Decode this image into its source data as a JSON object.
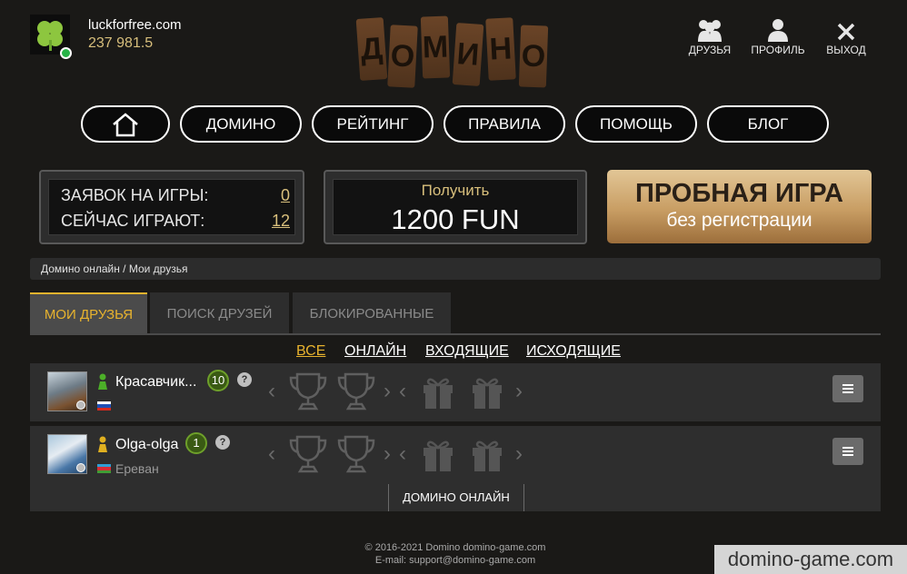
{
  "header": {
    "site_name": "luckforfree.com",
    "balance": "237 981.5",
    "brand_letters": [
      "Д",
      "О",
      "М",
      "И",
      "Н",
      "О"
    ],
    "links": [
      {
        "label": "ДРУЗЬЯ",
        "icon": "friends-icon"
      },
      {
        "label": "ПРОФИЛЬ",
        "icon": "profile-icon"
      },
      {
        "label": "ВЫХОД",
        "icon": "close-icon"
      }
    ]
  },
  "nav": [
    "ДОМИНО",
    "РЕЙТИНГ",
    "ПРАВИЛА",
    "ПОМОЩЬ",
    "БЛОГ"
  ],
  "stats": {
    "requests_label": "ЗАЯВОК НА ИГРЫ:",
    "requests_value": "0",
    "playing_label": "СЕЙЧАС ИГРАЮТ:",
    "playing_value": "12"
  },
  "bonus": {
    "label": "Получить",
    "amount": "1200 FUN"
  },
  "trial": {
    "title": "ПРОБНАЯ ИГРА",
    "subtitle": "без регистрации"
  },
  "breadcrumb": "Домино онлайн / Мои друзья",
  "tabs": [
    "МОИ ДРУЗЬЯ",
    "ПОИСК ДРУЗЕЙ",
    "БЛОКИРОВАННЫЕ"
  ],
  "filters": [
    "ВСЕ",
    "ОНЛАЙН",
    "ВХОДЯЩИЕ",
    "ИСХОДЯЩИЕ"
  ],
  "friends": [
    {
      "name": "Красавчик...",
      "level": "10",
      "city": "",
      "flag": "russia",
      "status_color": "#4caf28"
    },
    {
      "name": "Olga-olga",
      "level": "1",
      "city": "Ереван",
      "flag": "azerbaijan",
      "status_color": "#e0b020"
    }
  ],
  "bottom_tab": "ДОМИНО ОНЛАЙН",
  "footer": {
    "copyright": "© 2016-2021 Domino domino-game.com",
    "email": "E-mail: support@domino-game.com"
  },
  "watermark": "domino-game.com",
  "colors": {
    "accent": "#e8b32e",
    "gold_text": "#d8bf7c",
    "level_green": "#6ea02a"
  }
}
